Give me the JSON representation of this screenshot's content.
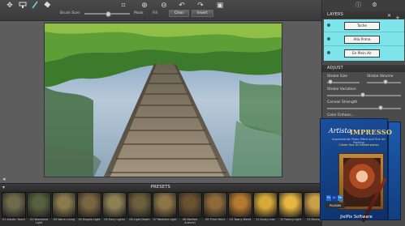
{
  "toolbar": {
    "brush_size_label": "Brush Size:",
    "mask_label": "Mask",
    "fill_label": "Fill",
    "clear_label": "Clear",
    "invert_label": "Invert",
    "icons": [
      "move-icon",
      "brush-icon",
      "pen-icon",
      "eraser-icon",
      "crop-icon",
      "zoom-in-icon",
      "zoom-out-icon",
      "undo-icon",
      "redo-icon",
      "save-icon",
      "compare-icon"
    ]
  },
  "right_panel": {
    "top_icons": [
      "info-icon",
      "gear-icon"
    ],
    "layers_header": "LAYERS",
    "layers": [
      {
        "name": "Tache"
      },
      {
        "name": "Alla Prima"
      },
      {
        "name": "En Plein Air"
      }
    ],
    "adjust_header": "ADJUST",
    "stroke_size_label": "Stroke Size",
    "stroke_volume_label": "Stroke Volume",
    "stroke_variation_label": "Stroke Variation",
    "canvas_strength_label": "Canvas Strength",
    "color_enhance_label": "Color Enhanc...",
    "stroke_size_value": 0.1,
    "stroke_volume_value": 0.55,
    "stroke_variation_value": 0.48,
    "canvas_strength_value": 0.72
  },
  "presets": {
    "title": "PRESETS",
    "items": [
      {
        "label": "01 Artistic Touch",
        "color": "#6e6b4a"
      },
      {
        "label": "02 Woodland Light",
        "color": "#57603d"
      },
      {
        "label": "03 Warm Living",
        "color": "#8a7a4e"
      },
      {
        "label": "04 Dapple Light",
        "color": "#7b6640"
      },
      {
        "label": "05 Early Lights",
        "color": "#8e8054"
      },
      {
        "label": "06 Light Depth",
        "color": "#6d5e3c"
      },
      {
        "label": "07 Wedded Light",
        "color": "#8e7548"
      },
      {
        "label": "08 Mottled Autumn",
        "color": "#6a5231"
      },
      {
        "label": "09 Thick Paint",
        "color": "#8e6a3a"
      },
      {
        "label": "10 Tawny Blend",
        "color": "#b47a2e"
      },
      {
        "label": "11 Dusty Lilac",
        "color": "#d8a936"
      },
      {
        "label": "12 Fading Light",
        "color": "#e5b640"
      },
      {
        "label": "13 Montagne",
        "color": "#cba045"
      },
      {
        "label": "14 Blue",
        "color": "#4f6f6c"
      },
      {
        "label": "15 Flowers",
        "color": "#c4913a"
      },
      {
        "label": "16 Soft Light",
        "color": "#b98b42"
      }
    ]
  },
  "product": {
    "brand": "Artista",
    "name": "IMPRESSO",
    "subtitle": "Impressionist Photo Effect and Fine Art Painting",
    "tagline": "Create Your Art Masterpieces",
    "plugin_label": "PLUGIN",
    "maker": "JixiPix Software"
  }
}
